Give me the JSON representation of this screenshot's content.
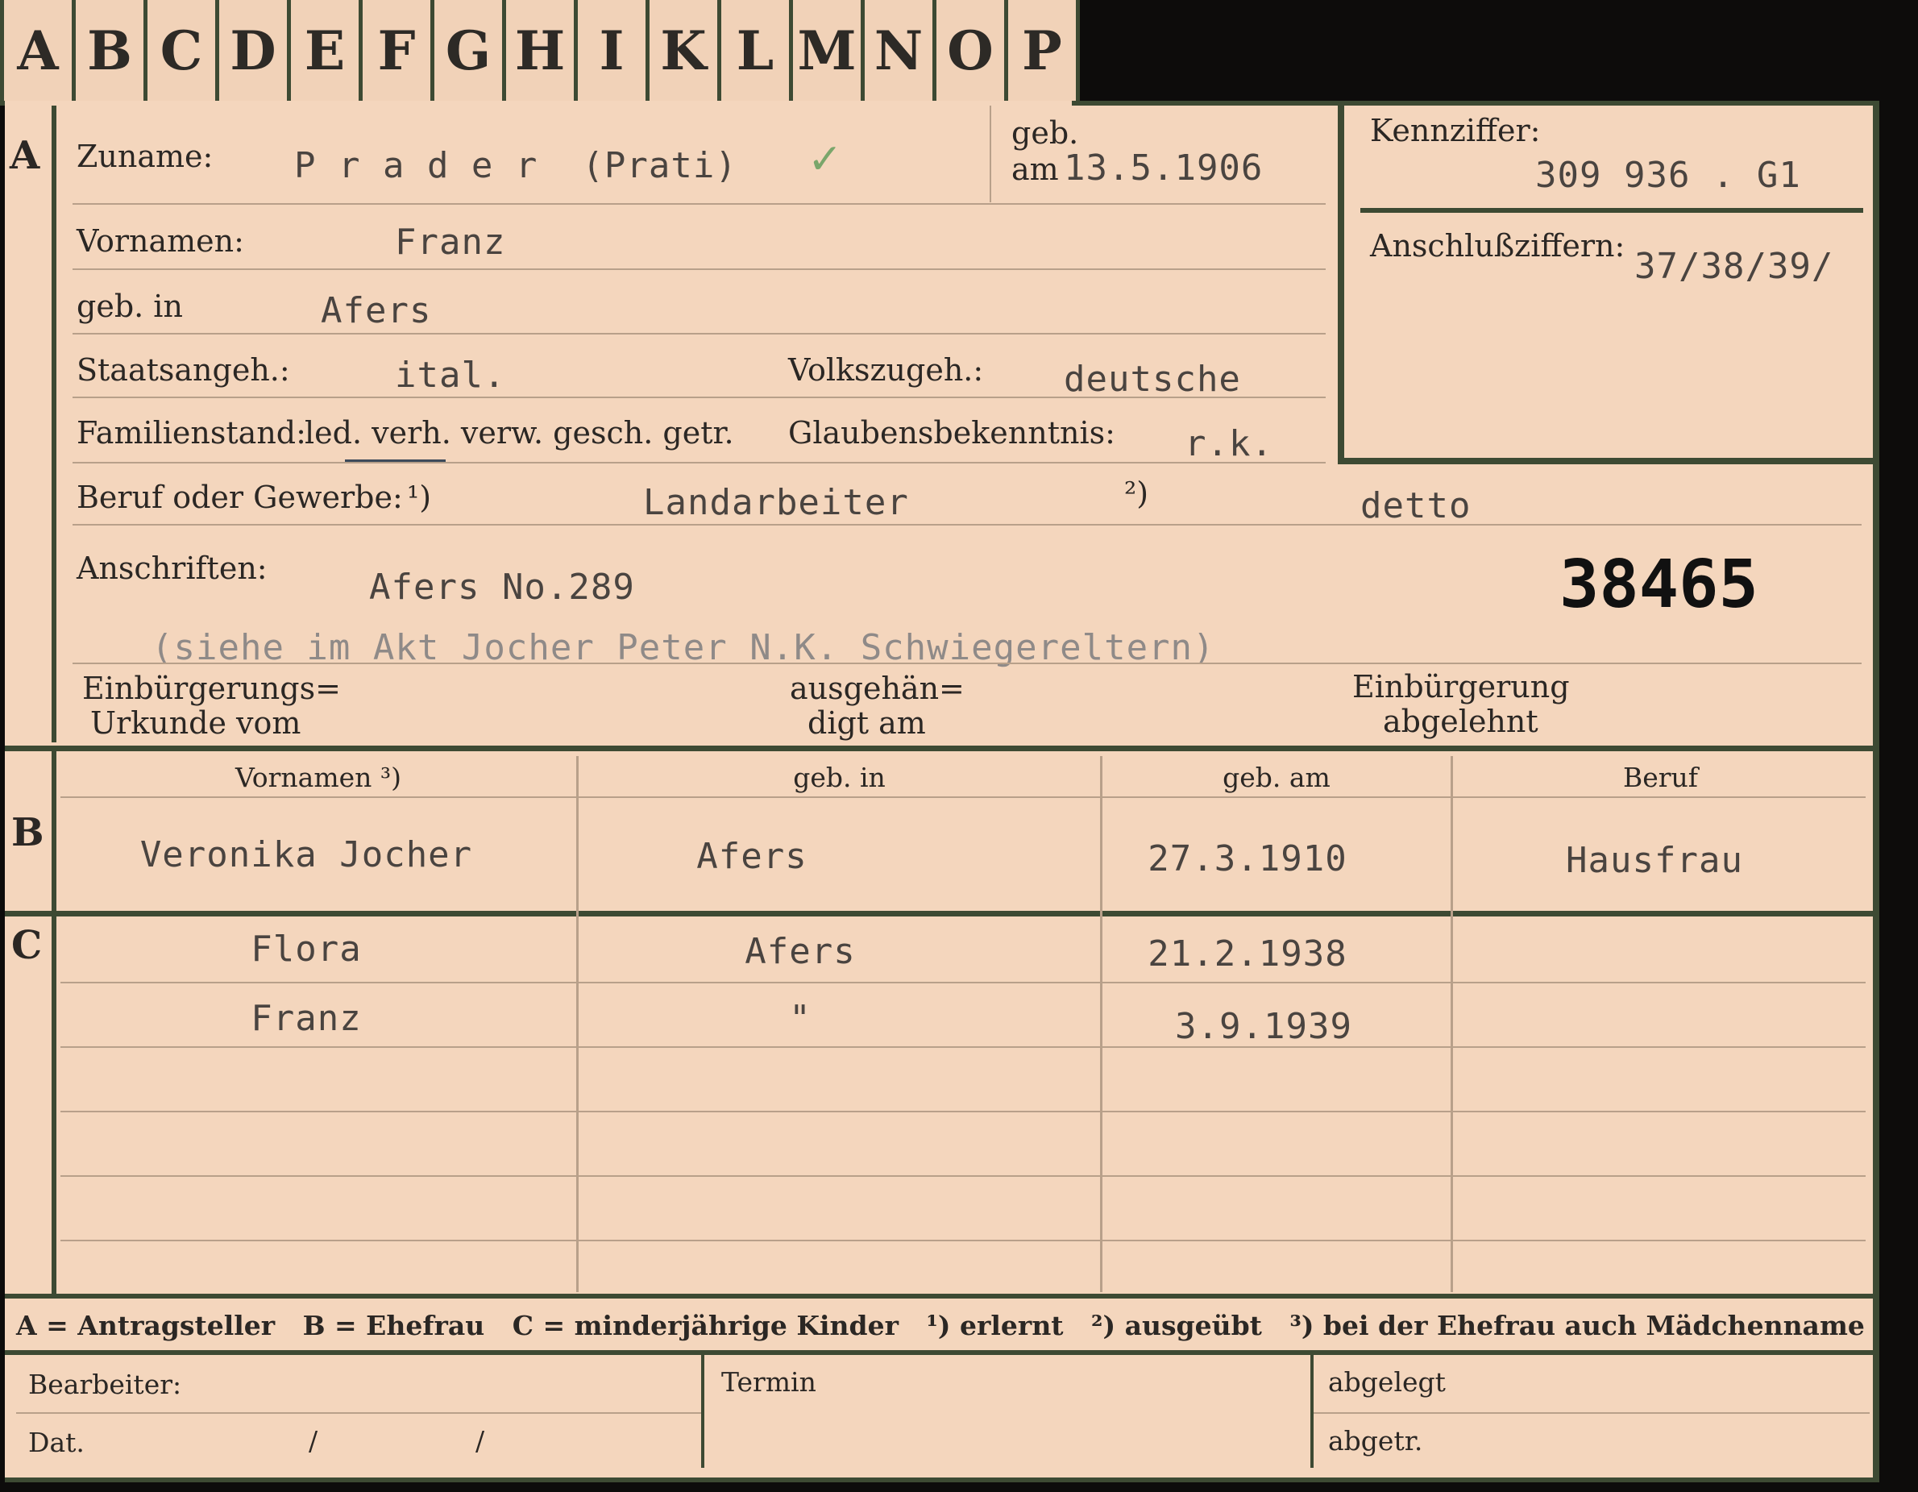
{
  "tabs": [
    "A",
    "B",
    "C",
    "D",
    "E",
    "F",
    "G",
    "H",
    "I",
    "K",
    "L",
    "M",
    "N",
    "O",
    "P"
  ],
  "section_a": {
    "marker": "A",
    "surname_label": "Zuname:",
    "surname": "P r a d e r  (Prati)",
    "check_mark": "✓",
    "birth_label_top": "geb.",
    "birth_label_am": "am",
    "birth_date": "13.5.1906",
    "kennziffer_label": "Kennziffer:",
    "kennziffer": "309 936 . G1",
    "anschluss_label": "Anschlußziffern:",
    "anschluss": "37/38/39/",
    "firstname_label": "Vornamen:",
    "firstname": "Franz",
    "birthplace_label": "geb. in",
    "birthplace": "Afers",
    "citizenship_label": "Staatsangeh.:",
    "citizenship": "ital.",
    "ethnicity_label": "Volkszugeh.:",
    "ethnicity": "deutsche",
    "marital_label": "Familienstand:",
    "marital_options": "led. verh. verw. gesch. getr.",
    "religion_label": "Glaubensbekenntnis:",
    "religion": "r.k.",
    "occupation_label": "Beruf oder Gewerbe:",
    "note1": "¹)",
    "occupation1": "Landarbeiter",
    "note2": "²)",
    "occupation2": "detto",
    "address_label": "Anschriften:",
    "address": "Afers No.289",
    "stamp_number": "38465",
    "address_note": "(siehe im Akt Jocher Peter N.K. Schwiegereltern)",
    "naturalization_label_1": "Einbürgerungs=",
    "naturalization_label_2": "Urkunde vom",
    "handed_label_1": "ausgehän=",
    "handed_label_2": "digt am",
    "refused_label_1": "Einbürgerung",
    "refused_label_2": "abgelehnt"
  },
  "section_b": {
    "marker": "B",
    "headers": [
      "Vornamen ³)",
      "geb. in",
      "geb. am",
      "Beruf"
    ],
    "row": [
      "Veronika Jocher",
      "Afers",
      "27.3.1910",
      "Hausfrau"
    ]
  },
  "section_c": {
    "marker": "C",
    "rows": [
      [
        "Flora",
        "Afers",
        "21.2.1938",
        ""
      ],
      [
        "Franz",
        "\"",
        "3.9.1939",
        ""
      ]
    ]
  },
  "legend": "A = Antragsteller   B = Ehefrau   C = minderjährige Kinder   ¹) erlernt   ²) ausgeübt   ³) bei der Ehefrau auch Mädchenname",
  "footer": {
    "bearbeiter_label": "Bearbeiter:",
    "dat_label": "Dat.",
    "slash1": "/",
    "slash2": "/",
    "termin_label": "Termin",
    "abgelegt_label": "abgelegt",
    "abgetr_label": "abgetr."
  }
}
